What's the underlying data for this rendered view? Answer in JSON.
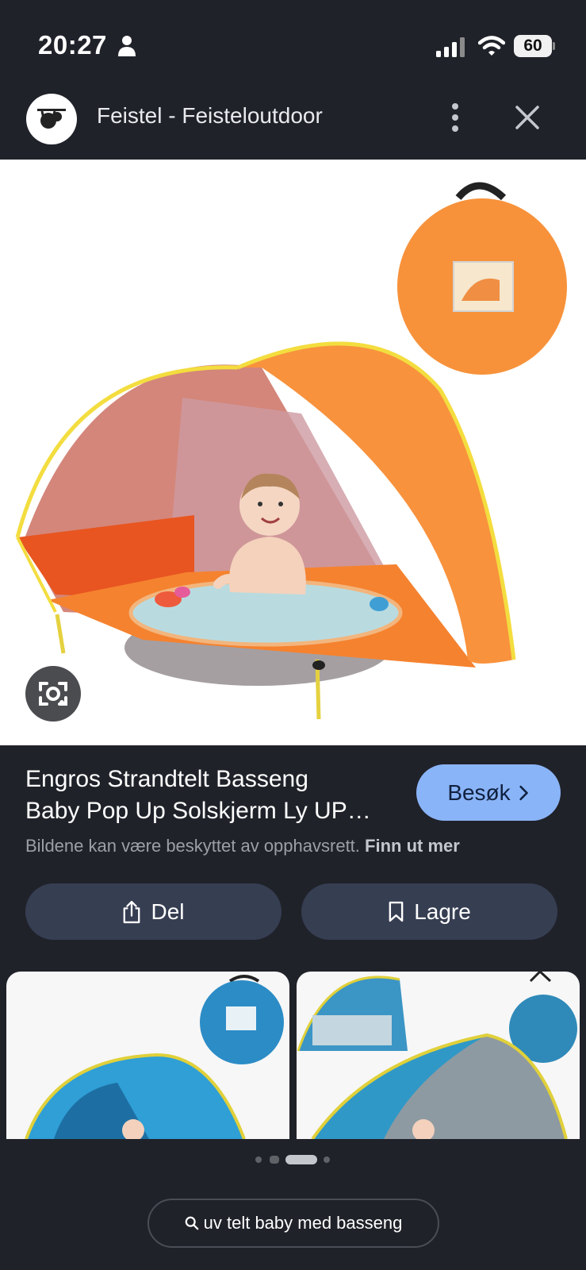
{
  "status_bar": {
    "time": "20:27",
    "battery": "60",
    "icons": [
      "person-icon",
      "signal-icon",
      "wifi-icon",
      "battery-icon"
    ]
  },
  "header": {
    "site_title": "Feistel - Feisteloutdoor",
    "icons": [
      "sloth-logo",
      "more-vert-icon",
      "close-icon"
    ]
  },
  "image": {
    "icons": [
      "lens-icon"
    ],
    "colors": {
      "tent": "#f7913a",
      "tent_inner": "#d8736a",
      "pool": "#b7dbe0",
      "trim": "#f3dd3f"
    }
  },
  "result": {
    "title_line1": "Engros Strandtelt Basseng",
    "title_line2": "Baby Pop Up Solskjerm Ly UP…",
    "visit_label": "Besøk",
    "copyright_text": "Bildene kan være beskyttet av opphavsrett.",
    "learn_more": "Finn ut mer"
  },
  "actions": {
    "share_label": "Del",
    "save_label": "Lagre"
  },
  "related": {
    "colors": {
      "tent": "#2f9fd6",
      "pouch": "#2c8cc6"
    }
  },
  "search": {
    "query": "uv telt baby med basseng"
  },
  "colors": {
    "background": "#20222a",
    "accent": "#8ab4f8",
    "button": "#363e52"
  }
}
